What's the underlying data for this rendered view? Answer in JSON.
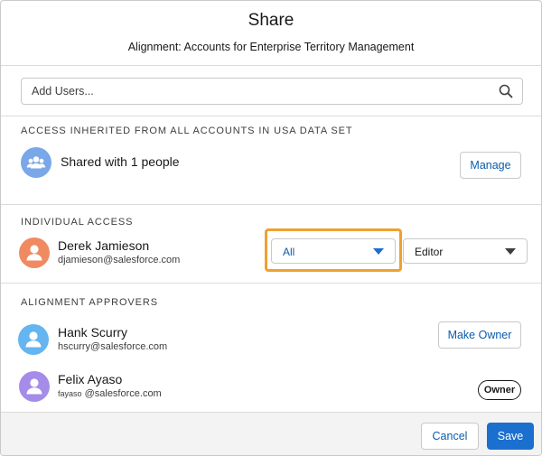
{
  "modal": {
    "title": "Share",
    "subtitle": "Alignment: Accounts for Enterprise Territory Management"
  },
  "search": {
    "placeholder": "Add Users..."
  },
  "inherited": {
    "section_label": "ACCESS INHERITED FROM ALL ACCOUNTS IN USA DATA SET",
    "group_label": "Shared with 1 people",
    "manage_label": "Manage"
  },
  "individual": {
    "section_label": "INDIVIDUAL ACCESS",
    "user": {
      "name": "Derek Jamieson",
      "email": "djamieson@salesforce.com",
      "scope_value": "All",
      "role_value": "Editor"
    }
  },
  "approvers": {
    "section_label": "ALIGNMENT APPROVERS",
    "items": [
      {
        "name": "Hank Scurry",
        "email": "hscurry@salesforce.com",
        "action_label": "Make Owner"
      },
      {
        "name": "Felix Ayaso",
        "email_user": "fayaso",
        "email_domain": " @salesforce.com",
        "badge_label": "Owner"
      }
    ]
  },
  "footer": {
    "cancel_label": "Cancel",
    "save_label": "Save"
  },
  "colors": {
    "accent": "#1b6fce",
    "link": "#0b5cab",
    "highlight": "#f0a030",
    "avatar_orange": "#f08a60",
    "avatar_blue": "#64b5f0",
    "avatar_purple": "#a48ce8",
    "group_avatar": "#7aa7e8"
  }
}
